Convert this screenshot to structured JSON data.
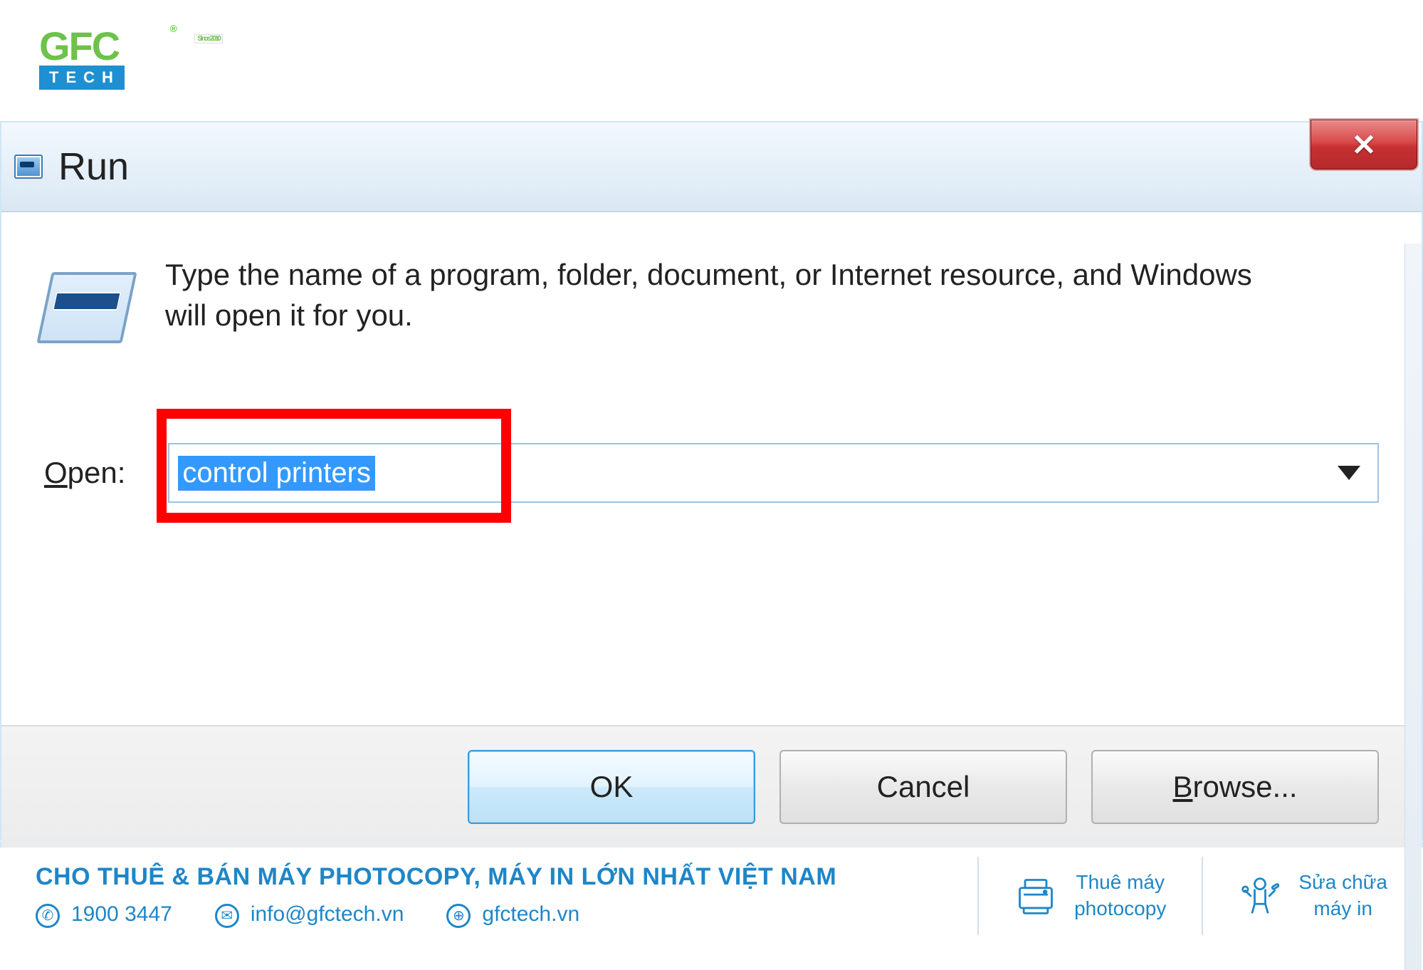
{
  "logo": {
    "brand_top": "GFC",
    "trademark": "®",
    "since": "Since 2010",
    "brand_bottom": "TECH"
  },
  "dialog": {
    "title": "Run",
    "close_label": "✕",
    "instruction": "Type the name of a program, folder, document, or Internet resource, and Windows will open it for you.",
    "open_label_prefix": "O",
    "open_label_rest": "pen:",
    "input_value": "control printers",
    "buttons": {
      "ok": "OK",
      "cancel": "Cancel",
      "browse_prefix": "B",
      "browse_rest": "rowse..."
    }
  },
  "footer": {
    "tagline": "CHO THUÊ & BÁN MÁY PHOTOCOPY, MÁY IN LỚN NHẤT VIỆT NAM",
    "phone": "1900 3447",
    "email": "info@gfctech.vn",
    "website": "gfctech.vn",
    "block1_line1": "Thuê máy",
    "block1_line2": "photocopy",
    "block2_line1": "Sửa chữa",
    "block2_line2": "máy in"
  }
}
